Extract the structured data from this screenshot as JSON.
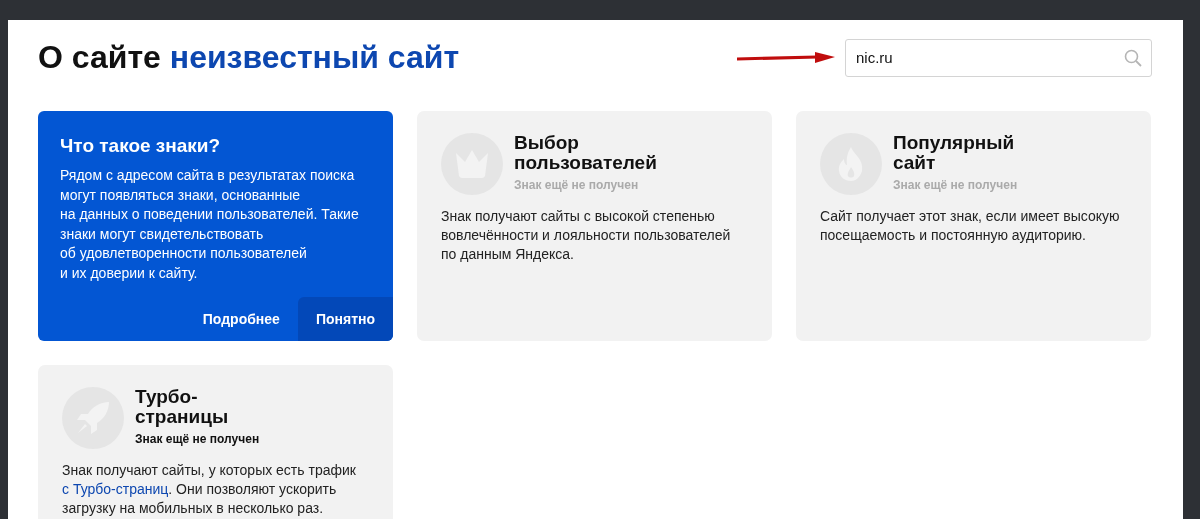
{
  "header": {
    "title": "О сайте",
    "site": "неизвестный сайт"
  },
  "search": {
    "value": "nic.ru"
  },
  "info_card": {
    "title": "Что такое знаки?",
    "text": "Рядом с адресом сайта в результатах поиска\nмогут появляться знаки, основанные\nна данных о поведении пользователей. Такие\nзнаки могут свидетельствовать\nоб удовлетворенности пользователей\nи их доверии к сайту.",
    "buttons": [
      {
        "label": "Подробнее",
        "selected": false
      },
      {
        "label": "Понятно",
        "selected": true
      }
    ]
  },
  "badges": [
    {
      "kind": "users_choice",
      "title": "Выбор пользователей",
      "status": "Знак ещё не получен",
      "dimmed": true,
      "description": [
        {
          "kind": "text",
          "text": "Знак получают сайты с высокой степенью вовлечённости и лояльности пользователей по данным Яндекса."
        }
      ]
    },
    {
      "kind": "popular",
      "title": "Популярный сайт",
      "status": "Знак ещё не получен",
      "dimmed": true,
      "description": [
        {
          "kind": "text",
          "text": "Сайт получает этот знак, если имеет высокую посещаемость и постоянную аудиторию."
        }
      ]
    },
    {
      "kind": "turbo",
      "title": "Турбо-страницы",
      "status": "Знак ещё не получен",
      "dimmed": false,
      "description": [
        {
          "kind": "text",
          "text": "Знак получают сайты, у которых есть трафик "
        },
        {
          "kind": "link",
          "text": "с Турбо-страниц"
        },
        {
          "kind": "text",
          "text": ". Они позволяют ускорить загрузку на мобильных в несколько раз."
        }
      ]
    }
  ]
}
